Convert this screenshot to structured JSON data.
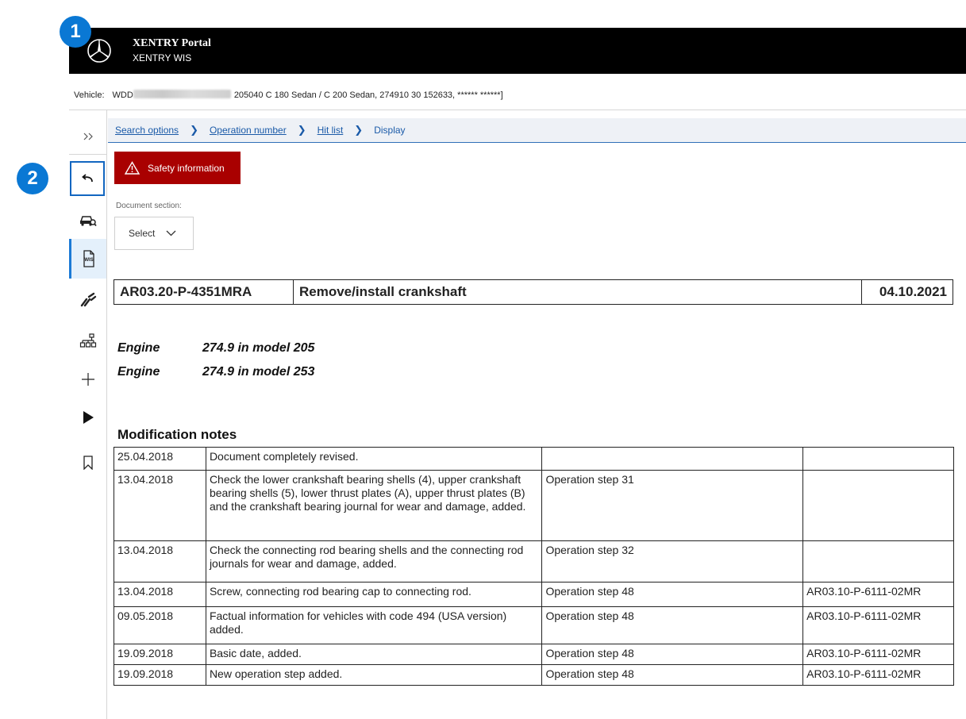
{
  "header": {
    "title": "XENTRY Portal",
    "subtitle": "XENTRY WIS"
  },
  "badges": [
    "1",
    "2"
  ],
  "vehicle": {
    "label": "Vehicle:",
    "vin_prefix": "WDD",
    "details": "205040 C 180 Sedan / C 200 Sedan, 274910 30 152633, ****** ******]"
  },
  "sidebar": {
    "items": [
      "expand-icon",
      "back-arrow-icon",
      "vehicle-search-icon",
      "wis-document-icon",
      "tools-icon",
      "structure-icon",
      "plus-icon",
      "play-icon",
      "bookmark-icon"
    ]
  },
  "breadcrumb": {
    "items": [
      "Search options",
      "Operation number",
      "Hit list"
    ],
    "current": "Display"
  },
  "safety_button": "Safety information",
  "document_section": {
    "label": "Document section:",
    "select_value": "Select"
  },
  "document": {
    "number": "AR03.20-P-4351MRA",
    "title": "Remove/install crankshaft",
    "date": "04.10.2021"
  },
  "engines": [
    {
      "label": "Engine",
      "value": "274.9 in model 205"
    },
    {
      "label": "Engine",
      "value": "274.9 in model 253"
    }
  ],
  "modification_notes": {
    "heading": "Modification notes",
    "rows": [
      [
        "25.04.2018",
        "Document completely revised.",
        "",
        ""
      ],
      [
        "13.04.2018",
        "Check the lower crankshaft bearing shells (4), upper crankshaft bearing shells (5), lower thrust plates (A), upper thrust plates (B) and the crankshaft bearing journal for wear and damage, added.",
        "Operation step 31",
        ""
      ],
      [
        "13.04.2018",
        "Check the connecting rod bearing shells and the connecting rod journals for wear and damage, added.",
        "Operation step 32",
        ""
      ],
      [
        "13.04.2018",
        "Screw, connecting rod bearing cap to connecting rod.",
        "Operation step 48",
        "AR03.10-P-6111-02MR"
      ],
      [
        "09.05.2018",
        "Factual information for vehicles with code 494 (USA version) added.",
        "Operation step 48",
        "AR03.10-P-6111-02MR"
      ],
      [
        "19.09.2018",
        "Basic date, added.",
        "Operation step 48",
        "AR03.10-P-6111-02MR"
      ],
      [
        "19.09.2018",
        "New operation step added.",
        "Operation step 48",
        "AR03.10-P-6111-02MR"
      ]
    ]
  },
  "colors": {
    "header_bg": "#000000",
    "badge": "#0a78d4",
    "safety_bg": "#a90000",
    "link": "#1a5aa8",
    "active_sidebar_bg": "#e4f0fb"
  }
}
